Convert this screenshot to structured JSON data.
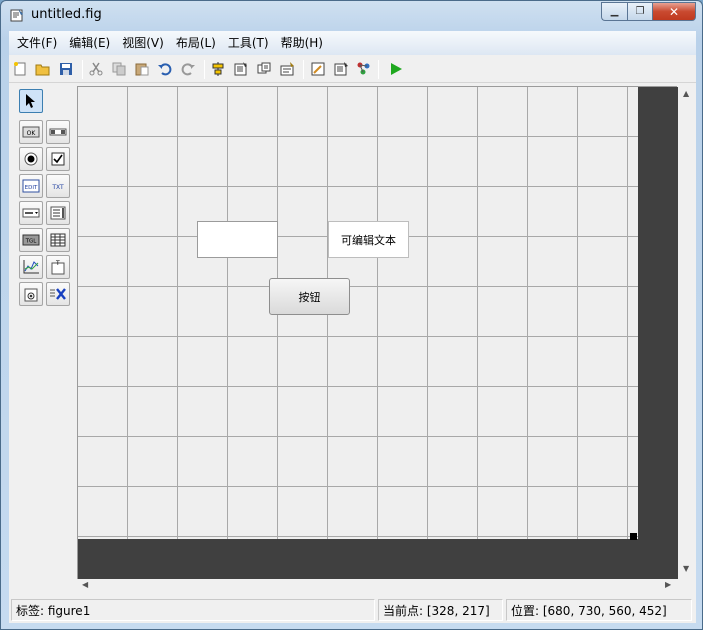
{
  "window": {
    "title": "untitled.fig",
    "min_glyph": "▁",
    "max_glyph": "❐",
    "close_glyph": "✕"
  },
  "menu": [
    "文件(F)",
    "编辑(E)",
    "视图(V)",
    "布局(L)",
    "工具(T)",
    "帮助(H)"
  ],
  "toolbar": {
    "icons": [
      "new-file-icon",
      "open-folder-icon",
      "save-icon",
      "cut-icon",
      "copy-icon",
      "paste-icon",
      "undo-icon",
      "redo-icon",
      "align-icon",
      "menu-editor-icon",
      "tab-order-icon",
      "toolbar-editor-icon",
      "editor-icon",
      "property-inspector-icon",
      "object-browser-icon",
      "run-icon"
    ]
  },
  "palette": {
    "items": [
      {
        "name": "select-tool",
        "glyph": "↖"
      },
      {
        "name": "push-button-tool",
        "glyph": "OK"
      },
      {
        "name": "slider-tool",
        "glyph": "▭"
      },
      {
        "name": "radio-button-tool",
        "glyph": "●"
      },
      {
        "name": "checkbox-tool",
        "glyph": "☑"
      },
      {
        "name": "edit-text-tool",
        "glyph": "EDIT"
      },
      {
        "name": "static-text-tool",
        "glyph": "TXT"
      },
      {
        "name": "popup-menu-tool",
        "glyph": "▤"
      },
      {
        "name": "listbox-tool",
        "glyph": "☰"
      },
      {
        "name": "toggle-button-tool",
        "glyph": "TGL"
      },
      {
        "name": "table-tool",
        "glyph": "▦"
      },
      {
        "name": "axes-tool",
        "glyph": "📈"
      },
      {
        "name": "panel-tool",
        "glyph": "T"
      },
      {
        "name": "button-group-tool",
        "glyph": "⊙"
      },
      {
        "name": "activex-tool",
        "glyph": "X"
      }
    ]
  },
  "canvas": {
    "static_text": "可编辑文本",
    "button_label": "按钮"
  },
  "status": {
    "tag_label": "标签: figure1",
    "current_point_label": "当前点:  [328, 217]",
    "position_label": "位置: [680, 730, 560, 452]"
  }
}
